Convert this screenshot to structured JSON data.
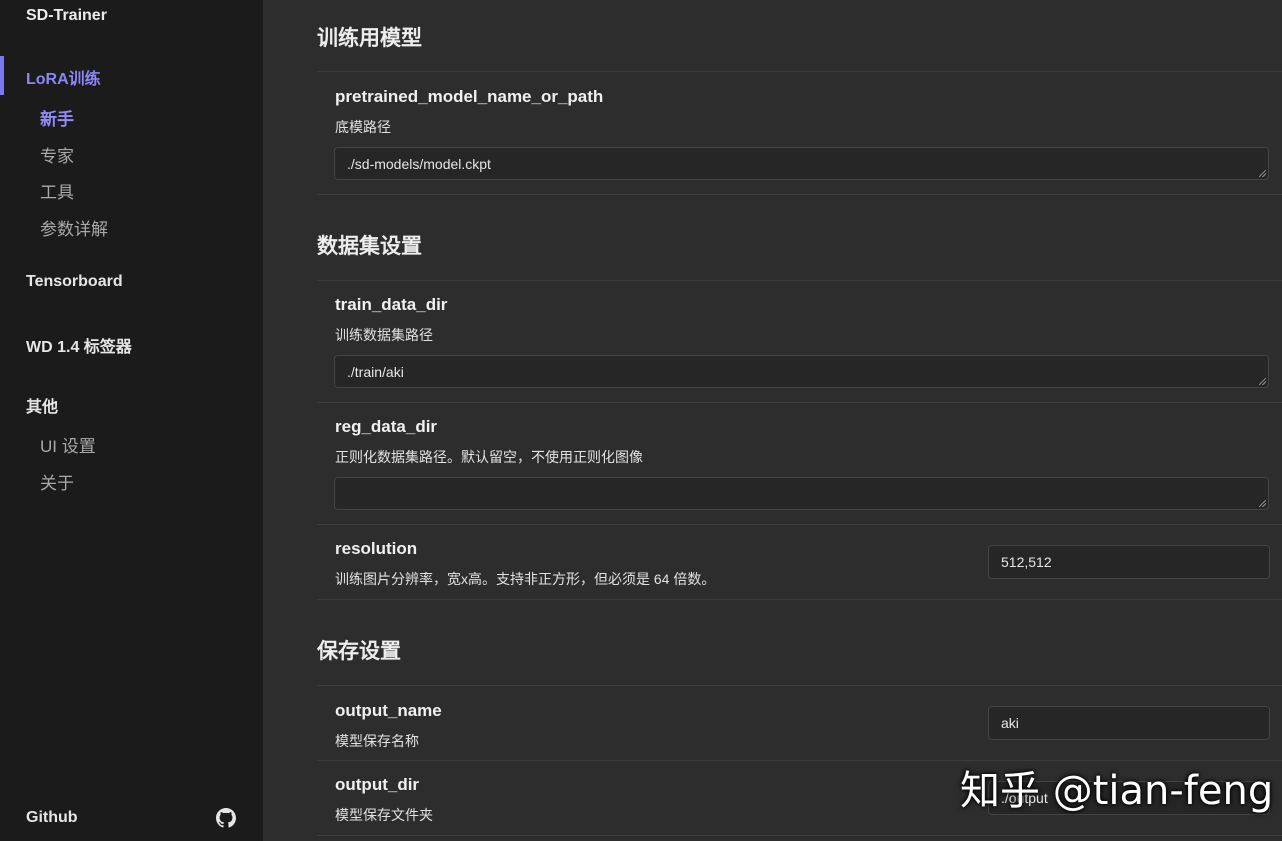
{
  "sidebar": {
    "brand": "SD-Trainer",
    "lora_group": "LoRA训练",
    "lora_items": [
      "新手",
      "专家",
      "工具",
      "参数详解"
    ],
    "tensorboard": "Tensorboard",
    "wd_tagger": "WD 1.4 标签器",
    "other_group": "其他",
    "other_items": [
      "UI 设置",
      "关于"
    ],
    "github": "Github"
  },
  "sections": {
    "model": {
      "title": "训练用模型",
      "pretrained": {
        "name": "pretrained_model_name_or_path",
        "desc": "底模路径",
        "value": "./sd-models/model.ckpt"
      }
    },
    "dataset": {
      "title": "数据集设置",
      "train_data_dir": {
        "name": "train_data_dir",
        "desc": "训练数据集路径",
        "value": "./train/aki"
      },
      "reg_data_dir": {
        "name": "reg_data_dir",
        "desc": "正则化数据集路径。默认留空，不使用正则化图像",
        "value": ""
      },
      "resolution": {
        "name": "resolution",
        "desc": "训练图片分辨率，宽x高。支持非正方形，但必须是 64 倍数。",
        "value": "512,512"
      }
    },
    "save": {
      "title": "保存设置",
      "output_name": {
        "name": "output_name",
        "desc": "模型保存名称",
        "value": "aki"
      },
      "output_dir": {
        "name": "output_dir",
        "desc": "模型保存文件夹",
        "value": "./output"
      }
    }
  },
  "watermark": "知乎 @tian-feng",
  "colors": {
    "accent": "#8a86f5",
    "sidebar_bg": "#1b1b1b",
    "main_bg": "#2d2d2d"
  },
  "icons": {
    "github": "github-icon"
  }
}
